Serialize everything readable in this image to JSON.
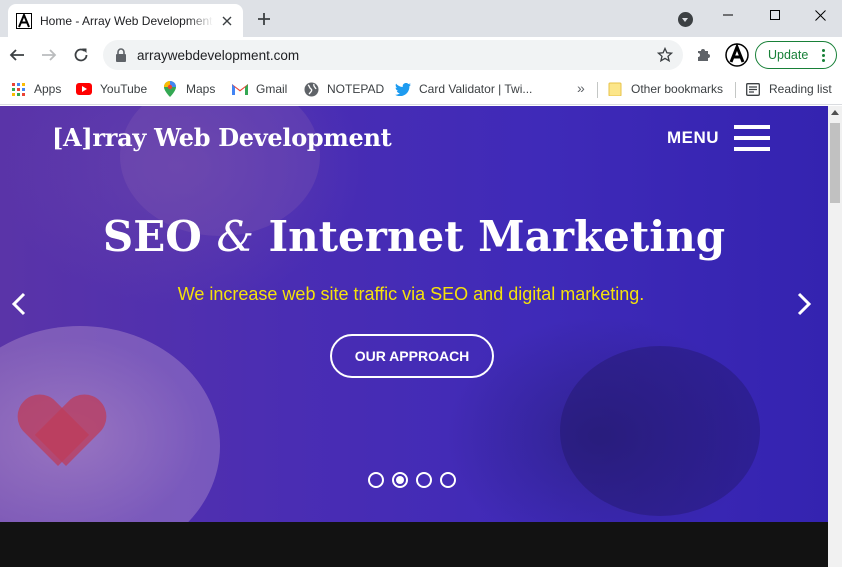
{
  "browser": {
    "tab": {
      "title": "Home - Array Web Development"
    },
    "address": {
      "url": "arraywebdevelopment.com"
    },
    "update_button": {
      "label": "Update"
    },
    "bookmarks": [
      {
        "label": "Apps",
        "icon": "apps-grid-icon"
      },
      {
        "label": "YouTube",
        "icon": "youtube-icon"
      },
      {
        "label": "Maps",
        "icon": "maps-pin-icon"
      },
      {
        "label": "Gmail",
        "icon": "gmail-icon"
      },
      {
        "label": "NOTEPAD",
        "icon": "globe-icon"
      },
      {
        "label": "Card Validator | Twi...",
        "icon": "twitter-icon"
      }
    ],
    "overflow": "»",
    "other_bookmarks": "Other bookmarks",
    "reading_list": "Reading list"
  },
  "site": {
    "brand": "[A]rray Web Development",
    "menu_label": "MENU",
    "slide": {
      "headline_before": "SEO",
      "headline_amp": "&",
      "headline_after": "Internet Marketing",
      "subtext": "We increase web site traffic via SEO and digital marketing.",
      "cta": "OUR APPROACH",
      "active_index": 1,
      "count": 4
    }
  },
  "colors": {
    "hero_purple": "#4a2db3",
    "subtext_yellow": "#f5e20a",
    "update_green": "#188038",
    "tabstrip": "#dee1e6"
  }
}
